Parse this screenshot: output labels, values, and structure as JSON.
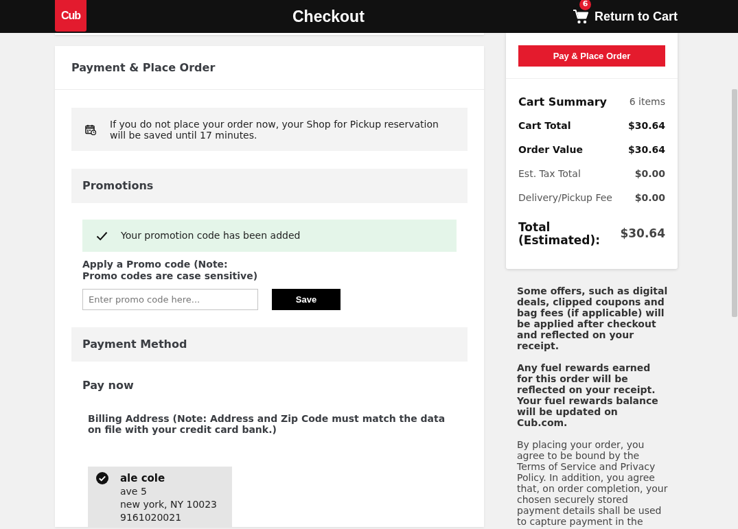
{
  "header": {
    "logo": "Cub",
    "title": "Checkout",
    "cart_count": "6",
    "cart_link": "Return to Cart"
  },
  "payment": {
    "title": "Payment & Place Order",
    "notice": "If you do not place your order now, your Shop for Pickup reservation will be saved until 17 minutes.",
    "promotions": {
      "title": "Promotions",
      "success_message": "Your promotion code has been added",
      "label": "Apply a Promo code (Note: Promo codes are case sensitive)",
      "placeholder": "Enter promo code here...",
      "button": "Save"
    },
    "payment_method": {
      "title": "Payment Method",
      "subtitle": "Pay now",
      "billing_note": "Billing Address (Note: Address and Zip Code must match the data on file with your credit card bank.)",
      "addresses": [
        {
          "name": "ale cole",
          "lines": [
            "ave 5",
            "new york, NY 10023",
            "9161020021"
          ],
          "selected": true
        }
      ]
    }
  },
  "summary": {
    "button": "Pay & Place Order",
    "title": "Cart Summary",
    "count": "6 items",
    "rows": [
      {
        "label": "Cart Total",
        "value": "$30.64",
        "kind": "strong"
      },
      {
        "label": "Order Value",
        "value": "$30.64",
        "kind": "strong"
      },
      {
        "label": "Est. Tax Total",
        "value": "$0.00",
        "kind": "plain"
      },
      {
        "label": "Delivery/Pickup Fee",
        "value": "$0.00",
        "kind": "plain"
      }
    ],
    "total": {
      "label": "Total (Estimated):",
      "value": "$30.64"
    }
  },
  "notes": [
    {
      "text": "Some offers, such as digital deals, clipped coupons and bag fees (if applicable) will be applied after checkout and reflected on your receipt.",
      "kind": "bold"
    },
    {
      "text": "Any fuel rewards earned for this order will be reflected on your receipt. Your fuel rewards balance will be updated on Cub.com.",
      "kind": "bold"
    },
    {
      "text": "By placing your order, you agree to be bound by the Terms of Service and Privacy Policy. In addition, you agree that, on order completion, your chosen securely stored payment details shall be used to capture payment in the",
      "kind": "plain"
    }
  ]
}
